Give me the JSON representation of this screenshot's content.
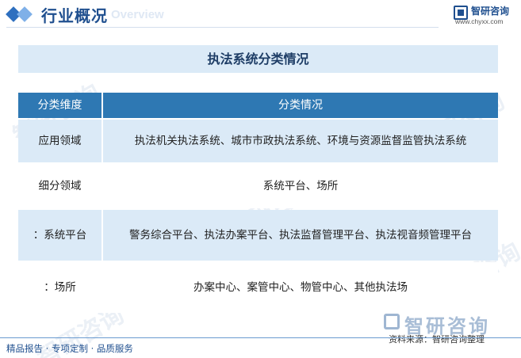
{
  "header": {
    "title": "行业概况",
    "subtitle": "Overview",
    "logo_name": "智研咨询",
    "logo_url": "www.chyxx.com"
  },
  "table_title": "执法系统分类情况",
  "table": {
    "columns": [
      "分类维度",
      "分类情况"
    ],
    "rows": [
      {
        "dimension": "应用领域",
        "detail": "执法机关执法系统、城市市政执法系统、环境与资源监督监管执法系统"
      },
      {
        "dimension": "细分领域",
        "detail": "系统平台、场所"
      },
      {
        "dimension": "：系统平台",
        "detail": "警务综合平台、执法办案平台、执法监督管理平台、执法视音频管理平台"
      },
      {
        "dimension": "：场所",
        "detail": "办案中心、案管中心、物管中心、其他执法场"
      }
    ]
  },
  "watermark": "智研咨询",
  "footer": {
    "left": "精品报告 · 专项定制 · 品质服务",
    "source": "资料来源：智研咨询整理"
  }
}
